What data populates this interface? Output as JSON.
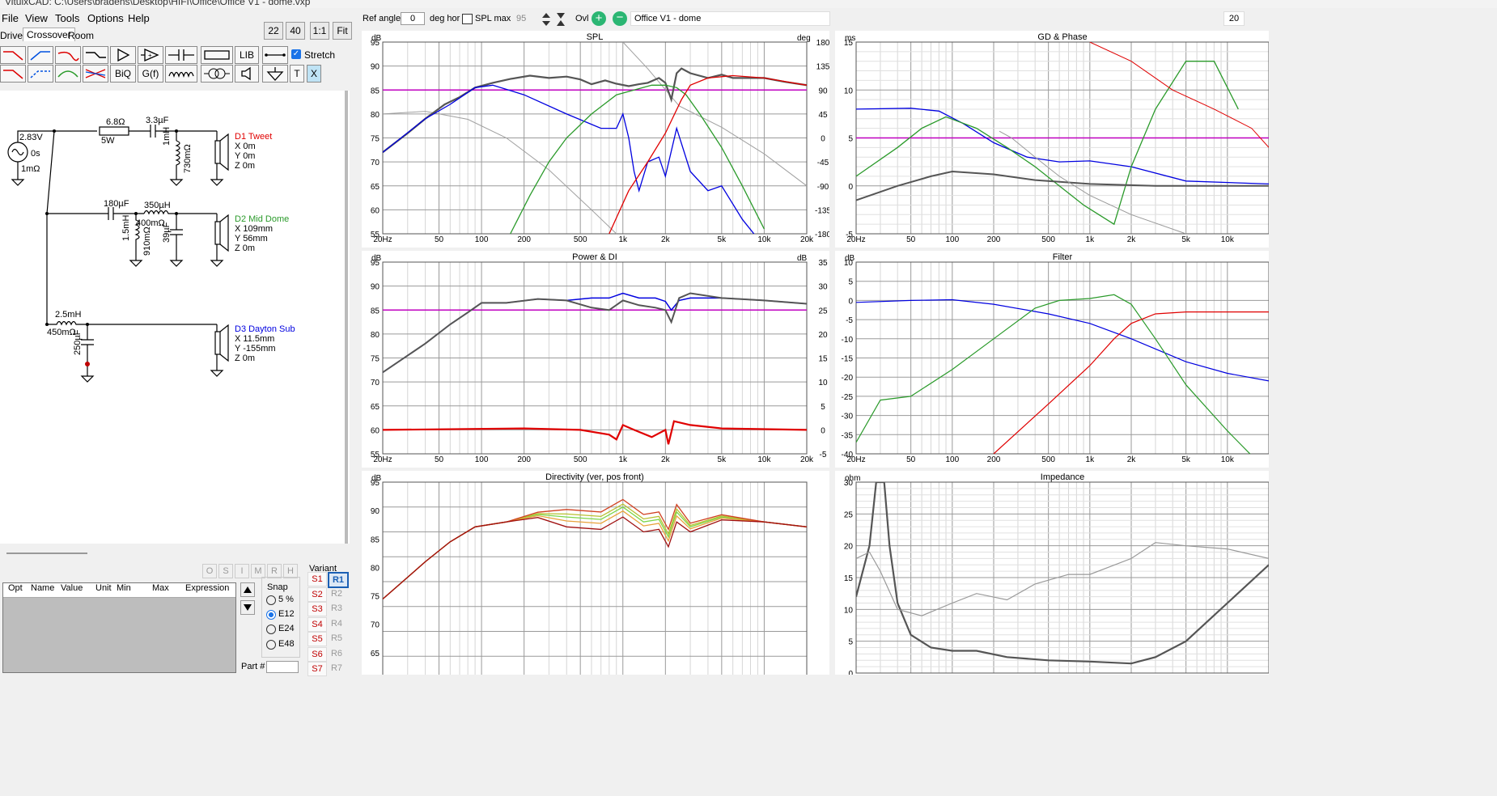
{
  "window": {
    "title": "VituixCAD: C:\\Users\\bradens\\Desktop\\HIFI\\Office\\Office V1 - dome.vxp"
  },
  "menu": [
    "File",
    "View",
    "Tools",
    "Options",
    "Help"
  ],
  "tabs": [
    "Drivers",
    "Crossover",
    "Room"
  ],
  "zoom_buttons": [
    "22",
    "40",
    "1:1",
    "Fit"
  ],
  "toolbar": {
    "lib": "LIB",
    "biq": "BiQ",
    "gf": "G(f)",
    "t": "T",
    "x": "X",
    "stretch": "Stretch"
  },
  "top": {
    "ref_angle_label": "Ref angle",
    "ref_angle_value": "0",
    "deg_hor": "deg hor",
    "spl_max_label": "SPL max",
    "spl_max_value": "95",
    "ovl": "Ovl",
    "project_name": "Office V1 - dome",
    "right_value": "20"
  },
  "schematic": {
    "source_voltage": "2.83V",
    "source_delay": "0s",
    "source_r": "1mΩ",
    "r1": "6.8Ω",
    "r1_power": "5W",
    "c1": "3.3µF",
    "l1": "1mH",
    "l1_r": "730mΩ",
    "c2": "180µF",
    "l2": "350µH",
    "l2_r": "400mΩ",
    "l3": "1.5mH",
    "l3_r": "910mΩ",
    "c3": "39µF",
    "l4": "2.5mH",
    "l4_r": "450mΩ",
    "c4": "250µF",
    "drivers": [
      {
        "name": "D1 Tweet",
        "color": "#e00000",
        "x": "X 0m",
        "y": "Y 0m",
        "z": "Z 0m"
      },
      {
        "name": "D2 Mid Dome",
        "color": "#2a9a2a",
        "x": "X 109mm",
        "y": "Y 56mm",
        "z": "Z 0m"
      },
      {
        "name": "D3 Dayton Sub",
        "color": "#0000e0",
        "x": "X 11.5mm",
        "y": "Y -155mm",
        "z": "Z 0m"
      }
    ]
  },
  "opt_table": {
    "headers": [
      "Opt",
      "Name",
      "Value",
      "Unit",
      "Min",
      "Max",
      "Expression"
    ]
  },
  "opt_buttons": [
    "O",
    "S",
    "I",
    "M",
    "R",
    "H"
  ],
  "snap": {
    "label": "Snap",
    "options": [
      "5 %",
      "E12",
      "E24",
      "E48"
    ],
    "selected": "E12"
  },
  "part_label": "Part #",
  "variant": {
    "label": "Variant",
    "s": [
      "S1",
      "S2",
      "S3",
      "S4",
      "S5",
      "S6",
      "S7"
    ],
    "r": [
      "R1",
      "R2",
      "R3",
      "R4",
      "R5",
      "R6",
      "R7"
    ]
  },
  "colors": {
    "tweet": "#e00000",
    "mid": "#2a9a2a",
    "sub": "#0000e0",
    "total": "#555555",
    "ref": "#c000c0"
  },
  "freq_ticks": [
    "20Hz",
    "50",
    "100",
    "200",
    "500",
    "1k",
    "2k",
    "5k",
    "10k",
    "20k"
  ],
  "chart_data": [
    {
      "type": "line",
      "title": "SPL",
      "ylabel": "dB",
      "y2label": "deg",
      "ylim": [
        55,
        95
      ],
      "y2lim": [
        -180,
        180
      ],
      "yticks": [
        "95",
        "90",
        "85",
        "80",
        "75",
        "70",
        "65",
        "60",
        "55"
      ],
      "y2ticks": [
        "180",
        "135",
        "90",
        "45",
        "0",
        "-45",
        "-90",
        "-135",
        "-180"
      ],
      "x": [
        20,
        50,
        100,
        200,
        500,
        1000,
        2000,
        5000,
        20000
      ],
      "series": [
        {
          "color": "#555555",
          "values": [
            72,
            82,
            87,
            88,
            87,
            87,
            89,
            88,
            86
          ]
        },
        {
          "color": "#2a9a2a",
          "values": [
            null,
            null,
            62,
            76,
            84,
            86,
            87,
            72,
            null
          ]
        },
        {
          "color": "#0000e0",
          "values": [
            72,
            82,
            86,
            83,
            78,
            80,
            65,
            62,
            null
          ]
        },
        {
          "color": "#e00000",
          "values": [
            null,
            null,
            null,
            null,
            null,
            66,
            83,
            88,
            86
          ]
        }
      ],
      "ref_line": 85
    },
    {
      "type": "line",
      "title": "GD & Phase",
      "ylabel": "ms",
      "ylim": [
        -5,
        15
      ],
      "yticks": [
        "15",
        "10",
        "5",
        "0",
        "-5"
      ],
      "xticks": [
        "20Hz",
        "50",
        "100",
        "200",
        "500",
        "1k",
        "2k",
        "5k",
        "10k"
      ],
      "ref_line": 5
    },
    {
      "type": "line",
      "title": "Power & DI",
      "ylabel": "dB",
      "y2label": "dB",
      "ylim": [
        55,
        95
      ],
      "y2lim": [
        -5,
        35
      ],
      "yticks": [
        "95",
        "90",
        "85",
        "80",
        "75",
        "70",
        "65",
        "60",
        "55"
      ],
      "y2ticks": [
        "35",
        "30",
        "25",
        "20",
        "15",
        "10",
        "5",
        "0",
        "-5"
      ],
      "ref_line": 85
    },
    {
      "type": "line",
      "title": "Filter",
      "ylabel": "dB",
      "ylim": [
        -40,
        10
      ],
      "yticks": [
        "10",
        "5",
        "0",
        "-5",
        "-10",
        "-15",
        "-20",
        "-25",
        "-30",
        "-35",
        "-40"
      ],
      "xticks": [
        "20Hz",
        "50",
        "100",
        "200",
        "500",
        "1k",
        "2k",
        "5k",
        "10k"
      ]
    },
    {
      "type": "line",
      "title": "Directivity (ver, pos front)",
      "ylabel": "dB",
      "ylim": [
        55,
        95
      ],
      "yticks": [
        "95",
        "90",
        "85",
        "80",
        "75",
        "70",
        "65",
        "60"
      ]
    },
    {
      "type": "line",
      "title": "Impedance",
      "ylabel": "ohm",
      "ylim": [
        0,
        30
      ],
      "yticks": [
        "30",
        "25",
        "20",
        "15",
        "10",
        "5",
        "0"
      ]
    }
  ]
}
